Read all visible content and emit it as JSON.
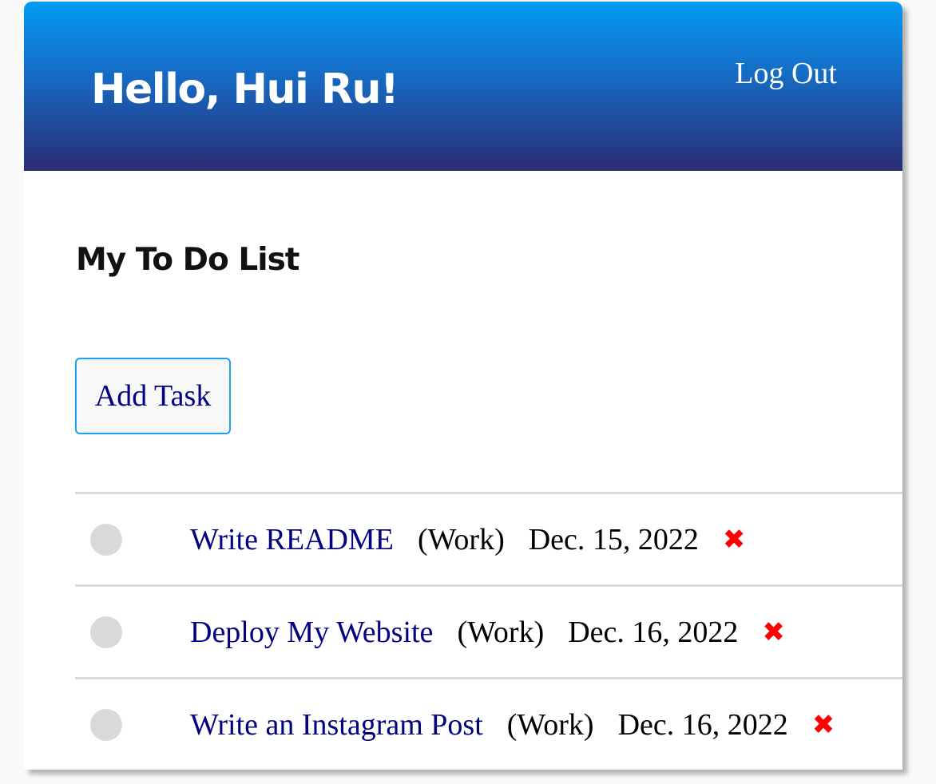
{
  "header": {
    "greeting": "Hello, Hui Ru!",
    "logout_label": "Log Out"
  },
  "main": {
    "title": "My To Do List",
    "add_task_label": "Add Task"
  },
  "tasks": [
    {
      "title": "Write README",
      "category": "(Work)",
      "date": "Dec. 15, 2022",
      "delete_icon": "✖"
    },
    {
      "title": "Deploy My Website",
      "category": "(Work)",
      "date": "Dec. 16, 2022",
      "delete_icon": "✖"
    },
    {
      "title": "Write an Instagram Post",
      "category": "(Work)",
      "date": "Dec. 16, 2022",
      "delete_icon": "✖"
    }
  ],
  "colors": {
    "header_top": "#039bf5",
    "header_bottom": "#2b2c72",
    "link": "#000080",
    "delete": "#ff0000",
    "button_border": "#1da1f2"
  }
}
